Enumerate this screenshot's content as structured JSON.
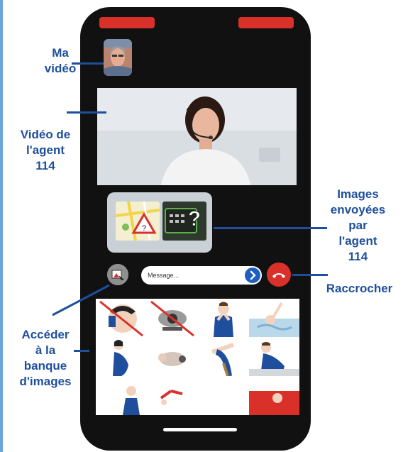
{
  "annotations": {
    "my_video": [
      "Ma",
      "vidéo"
    ],
    "agent_video": [
      "Vidéo de",
      "l'agent",
      "114"
    ],
    "images_sent": [
      "Images",
      "envoyées",
      "par",
      "l'agent",
      "114"
    ],
    "hang_up": "Raccrocher",
    "access_bank": [
      "Accéder",
      "à la",
      "banque",
      "d'images"
    ]
  },
  "phone": {
    "message_placeholder": "Message..."
  },
  "colors": {
    "annotation_blue": "#1d4f9c",
    "hangup_red": "#d9312a",
    "send_blue": "#1f5fbf",
    "phone_body": "#111111"
  },
  "icons": {
    "send": "arrow-right-icon",
    "hangup": "phone-hangup-icon",
    "gallery": "image-gallery-icon"
  }
}
